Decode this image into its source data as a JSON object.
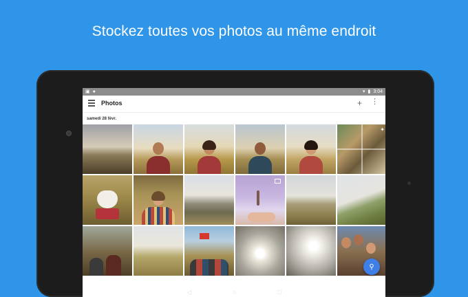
{
  "headline": "Stockez toutes vos photos au même endroit",
  "device": {
    "status_bar": {
      "time": "3:04"
    },
    "app_bar": {
      "title": "Photos"
    },
    "section": {
      "date": "samedi 28 févr."
    },
    "photos": [
      {
        "name": "sunset-field"
      },
      {
        "name": "man-sunglasses"
      },
      {
        "name": "woman-scarf"
      },
      {
        "name": "man-field"
      },
      {
        "name": "woman-smiling"
      },
      {
        "name": "group-album"
      },
      {
        "name": "dog-bandana"
      },
      {
        "name": "woman-blanket"
      },
      {
        "name": "hills-landscape"
      },
      {
        "name": "person-hand-video"
      },
      {
        "name": "meadow-landscape"
      },
      {
        "name": "hillside-landscape"
      },
      {
        "name": "people-sitting"
      },
      {
        "name": "grass-hill"
      },
      {
        "name": "group-flag"
      },
      {
        "name": "sun-clouds"
      },
      {
        "name": "sun-sky"
      },
      {
        "name": "group-selfie"
      }
    ]
  }
}
